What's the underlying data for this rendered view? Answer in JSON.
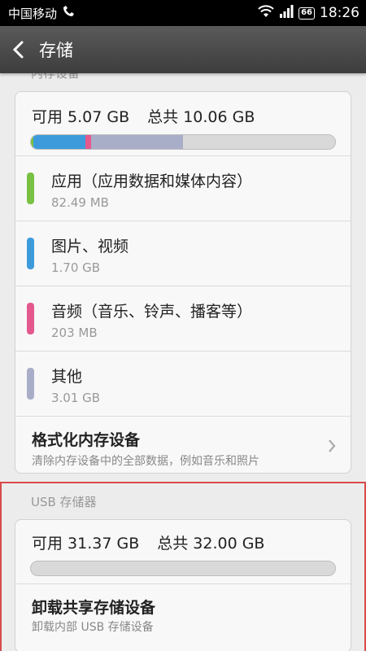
{
  "status_bar": {
    "carrier": "中国移动",
    "battery": "66",
    "time": "18:26"
  },
  "header": {
    "title": "存储"
  },
  "internal": {
    "section_label": "内存设备",
    "available_label": "可用 5.07 GB",
    "total_label": "总共 10.06 GB",
    "usage": {
      "total_gb": 10.06,
      "segments": [
        {
          "name": "应用",
          "gb": 0.08,
          "color": "#7ac143"
        },
        {
          "name": "图片、视频",
          "gb": 1.7,
          "color": "#3d9bdc"
        },
        {
          "name": "音频",
          "gb": 0.2,
          "color": "#e4588e"
        },
        {
          "name": "其他",
          "gb": 3.01,
          "color": "#a9aec8"
        }
      ]
    },
    "categories": [
      {
        "name": "应用（应用数据和媒体内容）",
        "size": "82.49 MB",
        "color": "#7ac143"
      },
      {
        "name": "图片、视频",
        "size": "1.70 GB",
        "color": "#3d9bdc"
      },
      {
        "name": "音频（音乐、铃声、播客等）",
        "size": "203 MB",
        "color": "#e4588e"
      },
      {
        "name": "其他",
        "size": "3.01 GB",
        "color": "#a9aec8"
      }
    ],
    "format": {
      "title": "格式化内存设备",
      "description": "清除内存设备中的全部数据，例如音乐和照片"
    }
  },
  "usb": {
    "section_label": "USB 存储器",
    "available_label": "可用 31.37 GB",
    "total_label": "总共 32.00 GB",
    "used_fraction": 0.0,
    "unmount": {
      "title": "卸载共享存储设备",
      "description": "卸载内部 USB 存储设备"
    }
  }
}
